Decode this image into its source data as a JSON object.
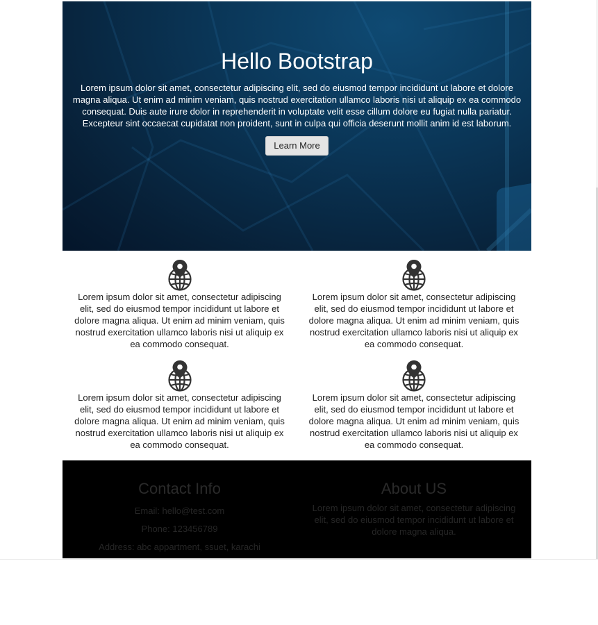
{
  "hero": {
    "title": "Hello Bootstrap",
    "text": "Lorem ipsum dolor sit amet, consectetur adipiscing elit, sed do eiusmod tempor incididunt ut labore et dolore magna aliqua. Ut enim ad minim veniam, quis nostrud exercitation ullamco laboris nisi ut aliquip ex ea commodo consequat. Duis aute irure dolor in reprehenderit in voluptate velit esse cillum dolore eu fugiat nulla pariatur. Excepteur sint occaecat cupidatat non proident, sunt in culpa qui officia deserunt mollit anim id est laborum.",
    "button_label": "Learn More"
  },
  "features": [
    {
      "icon": "globe-location-icon",
      "text": "Lorem ipsum dolor sit amet, consectetur adipiscing elit, sed do eiusmod tempor incididunt ut labore et dolore magna aliqua. Ut enim ad minim veniam, quis nostrud exercitation ullamco laboris nisi ut aliquip ex ea commodo consequat."
    },
    {
      "icon": "globe-location-icon",
      "text": "Lorem ipsum dolor sit amet, consectetur adipiscing elit, sed do eiusmod tempor incididunt ut labore et dolore magna aliqua. Ut enim ad minim veniam, quis nostrud exercitation ullamco laboris nisi ut aliquip ex ea commodo consequat."
    },
    {
      "icon": "globe-location-icon",
      "text": "Lorem ipsum dolor sit amet, consectetur adipiscing elit, sed do eiusmod tempor incididunt ut labore et dolore magna aliqua. Ut enim ad minim veniam, quis nostrud exercitation ullamco laboris nisi ut aliquip ex ea commodo consequat."
    },
    {
      "icon": "globe-location-icon",
      "text": "Lorem ipsum dolor sit amet, consectetur adipiscing elit, sed do eiusmod tempor incididunt ut labore et dolore magna aliqua. Ut enim ad minim veniam, quis nostrud exercitation ullamco laboris nisi ut aliquip ex ea commodo consequat."
    }
  ],
  "footer": {
    "contact": {
      "title": "Contact Info",
      "email": "Email: hello@test.com",
      "phone": "Phone: 123456789",
      "address": "Address: abc appartment, ssuet, karachi"
    },
    "about": {
      "title": "About US",
      "text": "Lorem ipsum dolor sit amet, consectetur adipiscing elit, sed do eiusmod tempor incididunt ut labore et dolore magna aliqua."
    }
  },
  "colors": {
    "hero_background": "#0a3556",
    "footer_background": "#000000",
    "footer_text": "#262626"
  }
}
